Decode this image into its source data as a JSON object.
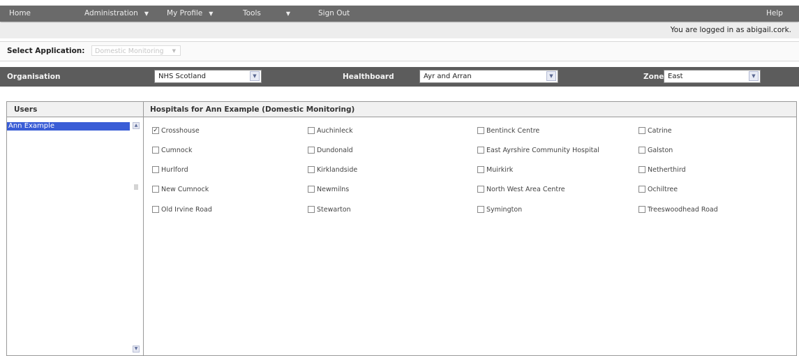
{
  "nav": {
    "home": "Home",
    "administration": "Administration",
    "my_profile": "My Profile",
    "tools": "Tools",
    "sign_out": "Sign Out",
    "help": "Help",
    "caret": "▼"
  },
  "login": {
    "text": "You are logged in as abigail.cork."
  },
  "application": {
    "label": "Select Application:",
    "value": "Domestic Monitoring"
  },
  "filters": {
    "organisation_label": "Organisation",
    "organisation_value": "NHS Scotland",
    "healthboard_label": "Healthboard",
    "healthboard_value": "Ayr and Arran",
    "zone_label": "Zone",
    "zone_value": "East"
  },
  "users": {
    "header": "Users",
    "items": [
      {
        "label": "Ann Example",
        "selected": true
      }
    ]
  },
  "hospitals": {
    "header": "Hospitals for Ann Example (Domestic Monitoring)",
    "items": [
      {
        "label": "Crosshouse",
        "checked": true
      },
      {
        "label": "Auchinleck",
        "checked": false
      },
      {
        "label": "Bentinck Centre",
        "checked": false
      },
      {
        "label": "Catrine",
        "checked": false
      },
      {
        "label": "Cumnock",
        "checked": false
      },
      {
        "label": "Dundonald",
        "checked": false
      },
      {
        "label": "East Ayrshire Community Hospital",
        "checked": false
      },
      {
        "label": "Galston",
        "checked": false
      },
      {
        "label": "Hurlford",
        "checked": false
      },
      {
        "label": "Kirklandside",
        "checked": false
      },
      {
        "label": "Muirkirk",
        "checked": false
      },
      {
        "label": "Netherthird",
        "checked": false
      },
      {
        "label": "New Cumnock",
        "checked": false
      },
      {
        "label": "Newmilns",
        "checked": false
      },
      {
        "label": "North West Area Centre",
        "checked": false
      },
      {
        "label": "Ochiltree",
        "checked": false
      },
      {
        "label": "Old Irvine Road",
        "checked": false
      },
      {
        "label": "Stewarton",
        "checked": false
      },
      {
        "label": "Symington",
        "checked": false
      },
      {
        "label": "Treeswoodhead Road",
        "checked": false
      }
    ]
  },
  "colors": {
    "nav_bg": "#6a6a6a",
    "filter_bg": "#5c5c5c",
    "selection": "#3a5dd6"
  }
}
